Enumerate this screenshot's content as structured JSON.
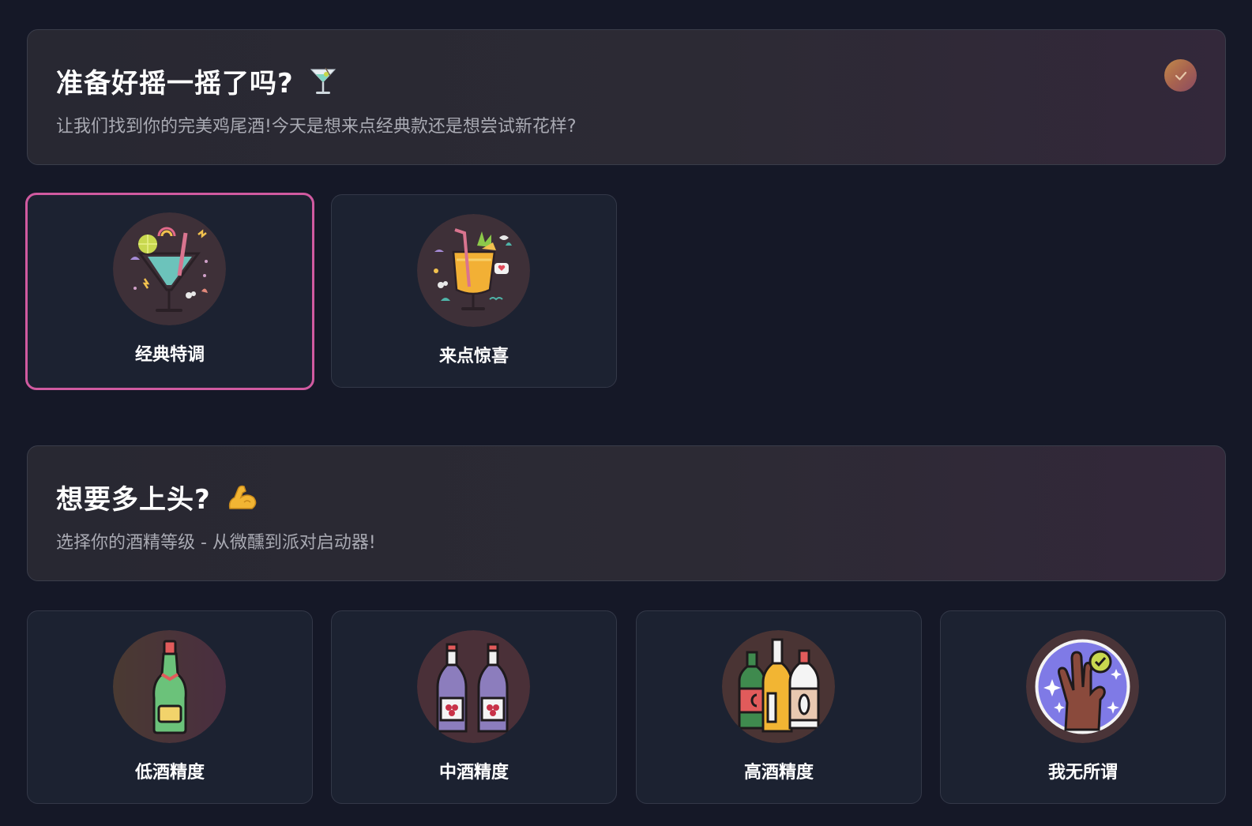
{
  "section1": {
    "title": "准备好摇一摇了吗?",
    "title_icon": "cocktail-glass-icon",
    "subtitle": "让我们找到你的完美鸡尾酒!今天是想来点经典款还是想尝试新花样?",
    "completed": true,
    "options": [
      {
        "label": "经典特调",
        "icon": "classic-cocktail-icon",
        "selected": true
      },
      {
        "label": "来点惊喜",
        "icon": "surprise-cocktail-icon",
        "selected": false
      }
    ]
  },
  "section2": {
    "title": "想要多上头?",
    "title_icon": "flexed-biceps-icon",
    "subtitle": "选择你的酒精等级 - 从微醺到派对启动器!",
    "options": [
      {
        "label": "低酒精度",
        "icon": "champagne-bottle-icon",
        "selected": false
      },
      {
        "label": "中酒精度",
        "icon": "wine-bottles-icon",
        "selected": false
      },
      {
        "label": "高酒精度",
        "icon": "liquor-bottles-icon",
        "selected": false
      },
      {
        "label": "我无所谓",
        "icon": "ok-hand-icon",
        "selected": false
      }
    ]
  },
  "colors": {
    "background": "#151827",
    "card": "#1c2231",
    "selected_border": "#d05aa0"
  }
}
